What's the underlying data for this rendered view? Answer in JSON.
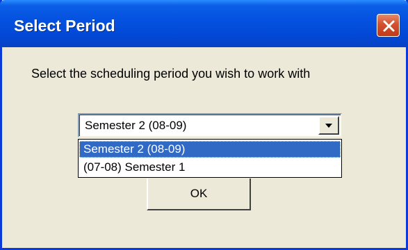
{
  "window": {
    "title": "Select Period",
    "close_icon": "close-icon"
  },
  "dialog": {
    "prompt": "Select the scheduling period you wish to work with",
    "period_select": {
      "selected_value": "Semester 2 (08-09)",
      "arrow_icon": "chevron-down-icon",
      "options": [
        {
          "label": "Semester 2 (08-09)",
          "highlighted": true
        },
        {
          "label": "(07-08) Semester 1",
          "highlighted": false
        }
      ]
    },
    "ok_label": "OK"
  },
  "colors": {
    "titlebar": "#0552e0",
    "window_body": "#ece9d8",
    "selection": "#316ac5",
    "close_button": "#d4502e"
  }
}
